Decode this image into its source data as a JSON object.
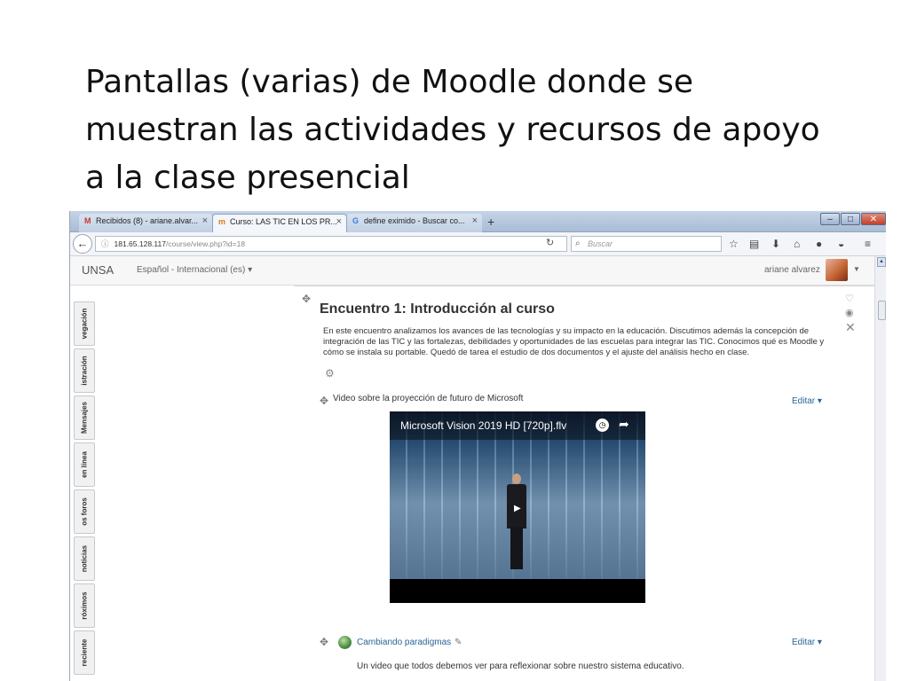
{
  "slide": {
    "title_lines": [
      "Pantallas (varias) de Moodle donde se",
      "muestran las actividades y recursos de apoyo",
      "a la clase presencial"
    ]
  },
  "browser": {
    "tabs": [
      {
        "favicon": "gmail-icon",
        "glyph": "M",
        "color": "#c8372d",
        "label": "Recibidos (8) - ariane.alvar..."
      },
      {
        "favicon": "moodle-icon",
        "glyph": "m",
        "color": "#e07b1c",
        "label": "Curso: LAS TIC EN LOS PR..."
      },
      {
        "favicon": "google-icon",
        "glyph": "G",
        "color": "#3b7de1",
        "label": "define eximido - Buscar co..."
      }
    ],
    "new_tab": "+",
    "url_host": "181.65.128.117",
    "url_path": "/course/view.php?id=18",
    "search_placeholder": "Buscar"
  },
  "moodle": {
    "site_name": "UNSA",
    "language": "Español - Internacional (es) ▾",
    "user_name": "ariane alvarez",
    "dock_tabs": [
      "vegación",
      "istración",
      "Mensajes",
      "en línea",
      "os foros",
      "noticias",
      "róximos",
      "reciente"
    ],
    "section": {
      "title": "Encuentro 1: Introducción al curso",
      "summary": "En este encuentro analizamos los avances de las tecnologías y su impacto en la educación. Discutimos además la concepción de integración de las TIC y las fortalezas, debilidades y oportunidades de las escuelas para integrar las TIC. Conocimos qué es Moodle y cómo se instala su portable. Quedó de tarea el estudio de dos documentos y el ajuste del análisis hecho en clase."
    },
    "activities": [
      {
        "label": "Video sobre la proyección de futuro de Microsoft",
        "edit": "Editar ▾",
        "video_title": "Microsoft Vision 2019 HD [720p].flv"
      },
      {
        "label": "Cambiando paradigmas",
        "edit": "Editar ▾",
        "description": "Un video que todos debemos ver para reflexionar sobre nuestro sistema educativo."
      }
    ]
  }
}
